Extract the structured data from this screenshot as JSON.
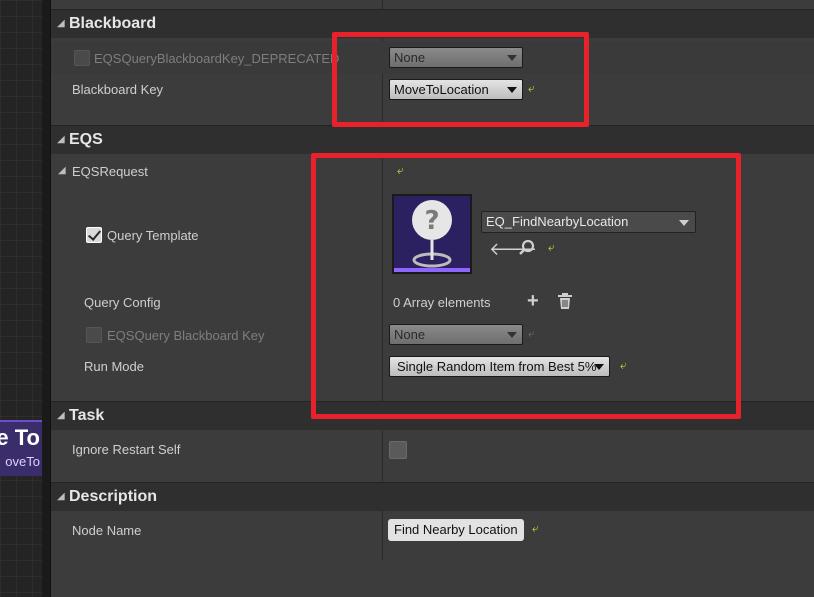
{
  "graph": {
    "node_title": "e To",
    "node_subtitle": "oveTo"
  },
  "categories": {
    "blackboard": "Blackboard",
    "eqs": "EQS",
    "task": "Task",
    "description": "Description"
  },
  "blackboard": {
    "deprecated_label": "EQSQueryBlackboardKey_DEPRECATED",
    "deprecated_value": "None",
    "key_label": "Blackboard Key",
    "key_value": "MoveToLocation"
  },
  "eqs": {
    "request_label": "EQSRequest",
    "query_template_label": "Query Template",
    "query_template_checked": true,
    "query_template_asset": "EQ_FindNearbyLocation",
    "query_config_label": "Query Config",
    "query_config_value": "0 Array elements",
    "bb_key_label": "EQSQuery Blackboard Key",
    "bb_key_value": "None",
    "run_mode_label": "Run Mode",
    "run_mode_value": "Single Random Item from Best 5%"
  },
  "task": {
    "ignore_restart_label": "Ignore Restart Self",
    "ignore_restart_checked": false
  },
  "description": {
    "node_name_label": "Node Name",
    "node_name_value": "Find Nearby Location"
  },
  "colors": {
    "highlight": "#e8212a",
    "reset_arrow": "#d8d23a",
    "asset_accent": "#8e66ff"
  },
  "icons": [
    "reset-arrow-icon",
    "use-selected-arrow-icon",
    "browse-magnifier-icon",
    "add-plus-icon",
    "trash-icon",
    "question-marker-icon",
    "chevron-down-icon"
  ]
}
